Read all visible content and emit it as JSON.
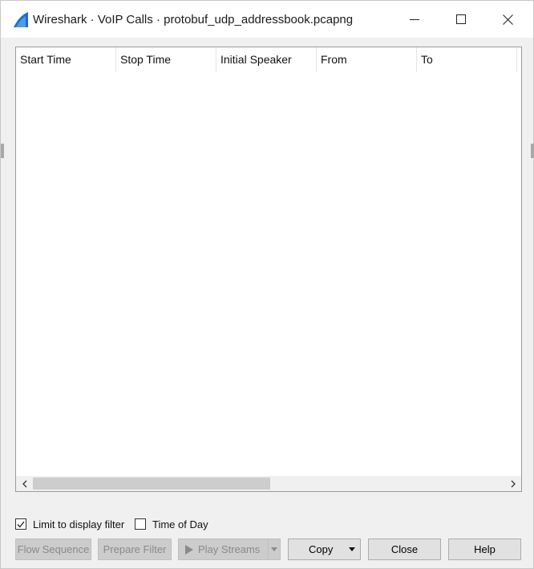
{
  "window": {
    "title": "Wireshark · VoIP Calls · protobuf_udp_addressbook.pcapng",
    "app_icon": "wireshark-fin-icon",
    "accent_color": "#1c6dd0"
  },
  "table": {
    "columns": [
      "Start Time",
      "Stop Time",
      "Initial Speaker",
      "From",
      "To"
    ],
    "rows": []
  },
  "options": {
    "limit_to_display_filter": {
      "label": "Limit to display filter",
      "checked": true
    },
    "time_of_day": {
      "label": "Time of Day",
      "checked": false
    }
  },
  "buttons": {
    "flow_sequence": "Flow Sequence",
    "prepare_filter": "Prepare Filter",
    "play_streams": "Play Streams",
    "copy": "Copy",
    "close": "Close",
    "help": "Help"
  }
}
